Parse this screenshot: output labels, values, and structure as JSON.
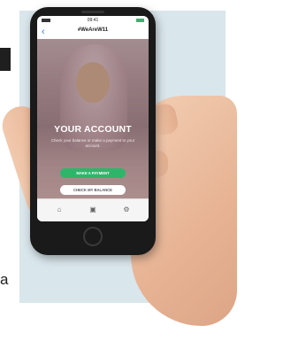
{
  "status_bar": {
    "time": "09:41"
  },
  "app": {
    "nav_title": "#WeAreW11",
    "back_icon": "chevron-left-icon"
  },
  "hero": {
    "headline": "YOUR ACCOUNT",
    "subtext": "Check your balance or make a payment to your account.",
    "primary_button": "MAKE A PAYMENT",
    "secondary_button": "CHECK MY BALANCE"
  },
  "tabbar": {
    "items": [
      {
        "icon": "home-icon"
      },
      {
        "icon": "cart-icon"
      },
      {
        "icon": "settings-icon"
      }
    ]
  },
  "page": {
    "side_letter": "a"
  },
  "colors": {
    "accent_green": "#2fb56a",
    "back_blue": "#2a7de1",
    "background_panel": "#d9e6ec"
  }
}
